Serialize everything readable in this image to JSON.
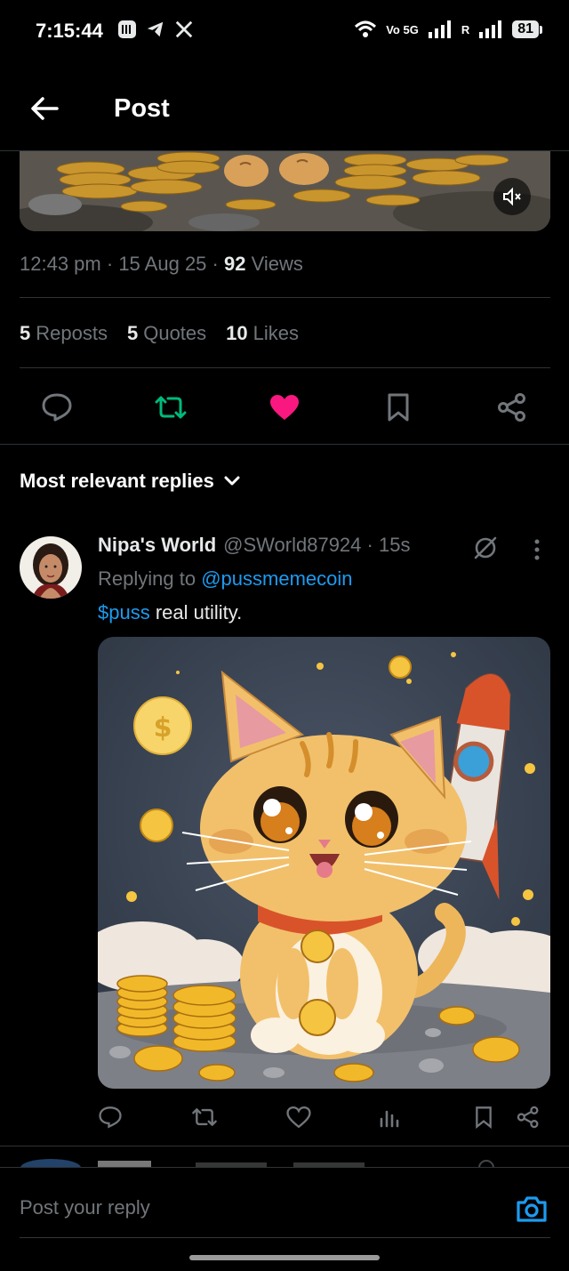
{
  "status_bar": {
    "time": "7:15:44",
    "network_label": "Vo 5G",
    "roaming_label": "R",
    "battery": "81"
  },
  "header": {
    "title": "Post"
  },
  "post": {
    "time": "12:43 pm",
    "date": "15 Aug 25",
    "views_count": "92",
    "views_label": "Views",
    "reposts_count": "5",
    "reposts_label": "Reposts",
    "quotes_count": "5",
    "quotes_label": "Quotes",
    "likes_count": "10",
    "likes_label": "Likes",
    "liked": true,
    "reposted": true,
    "colors": {
      "repost_active": "#00ba7c",
      "like_active": "#f91880",
      "link": "#1d9bf0"
    }
  },
  "replies_sort": {
    "label": "Most relevant replies"
  },
  "reply": {
    "name": "Nipa's World",
    "handle": "@SWorld87924",
    "age": "15s",
    "replying_prefix": "Replying to",
    "replying_to": "@pussmemecoin",
    "cashtag": "$puss",
    "text": " real utility.",
    "image_icon": "cartoon-cat-rocket-coins"
  },
  "composer": {
    "placeholder": "Post your reply"
  }
}
